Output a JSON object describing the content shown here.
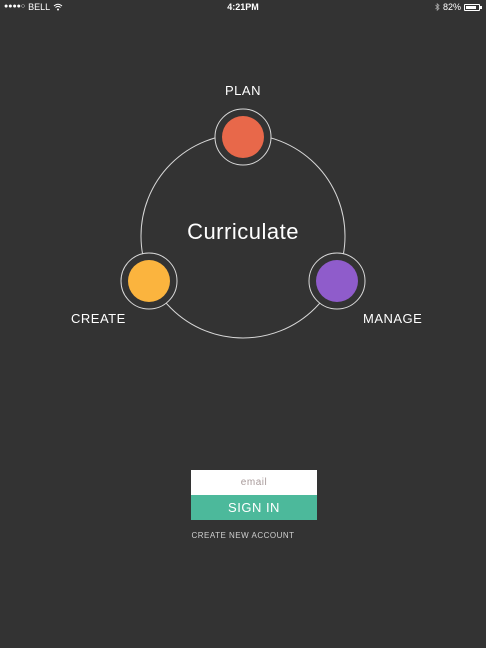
{
  "status_bar": {
    "carrier": "BELL",
    "time": "4:21PM",
    "battery_percent": "82%",
    "battery_level": 0.82,
    "signal_icon": "signal-dots-icon",
    "wifi_icon": "wifi-icon",
    "bluetooth_icon": "bluetooth-icon"
  },
  "diagram": {
    "title": "Curriculate",
    "nodes": [
      {
        "label": "PLAN",
        "color": "#e8684a"
      },
      {
        "label": "CREATE",
        "color": "#fbb43e"
      },
      {
        "label": "MANAGE",
        "color": "#8f5ccb"
      }
    ]
  },
  "login": {
    "email_placeholder": "email",
    "sign_in_label": "SIGN IN",
    "sign_in_color": "#4cb99b",
    "create_account_label": "CREATE NEW ACCOUNT"
  }
}
